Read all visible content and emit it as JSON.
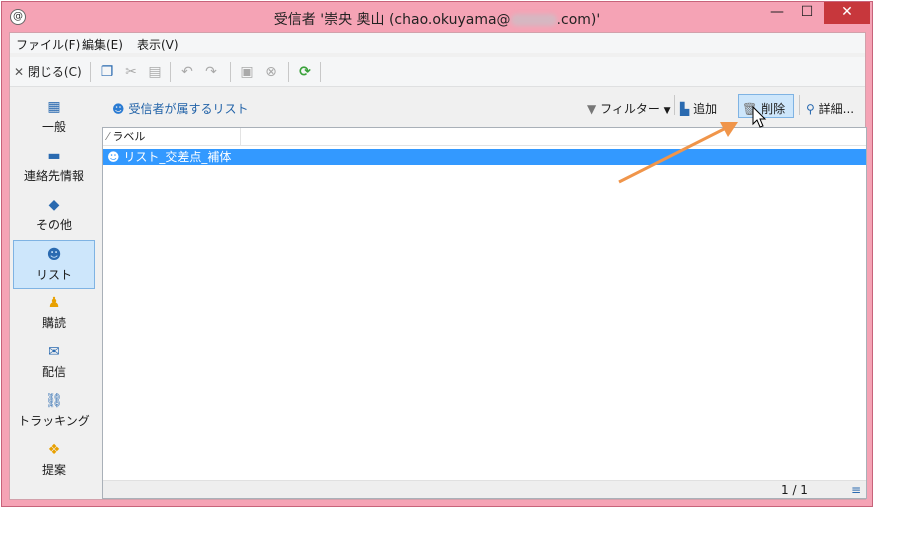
{
  "window": {
    "title": "受信者 '崇央 奥山 (chao.okuyama@",
    "title_suffix": ".com)'",
    "min_glyph": "—",
    "max_glyph": "☐",
    "close_glyph": "✕"
  },
  "menu": [
    "ファイル(F)",
    "編集(E)",
    "表示(V)"
  ],
  "toolbar": {
    "close_label": "閉じる(C)"
  },
  "sidebar": [
    {
      "label": "一般",
      "icon": "clipboard-icon"
    },
    {
      "label": "連絡先情報",
      "icon": "contact-card-icon"
    },
    {
      "label": "その他",
      "icon": "cube-icon"
    },
    {
      "label": "リスト",
      "icon": "list-users-icon"
    },
    {
      "label": "購読",
      "icon": "person-icon"
    },
    {
      "label": "配信",
      "icon": "envelope-icon"
    },
    {
      "label": "トラッキング",
      "icon": "link-icon"
    },
    {
      "label": "提案",
      "icon": "gift-icon"
    }
  ],
  "main": {
    "sub_link": "受信者が属するリスト",
    "filter_label": "フィルター",
    "add_label": "追加",
    "delete_label": "削除",
    "detail_label": "詳細..."
  },
  "grid": {
    "column_label": "ラベル",
    "rows": [
      "リスト_交差点_補体"
    ],
    "pager": "1 / 1"
  },
  "colors": {
    "title_bar": "#f5a3b5",
    "selection": "#3399ff",
    "arrow": "#f0954a",
    "close": "#c7373c"
  }
}
